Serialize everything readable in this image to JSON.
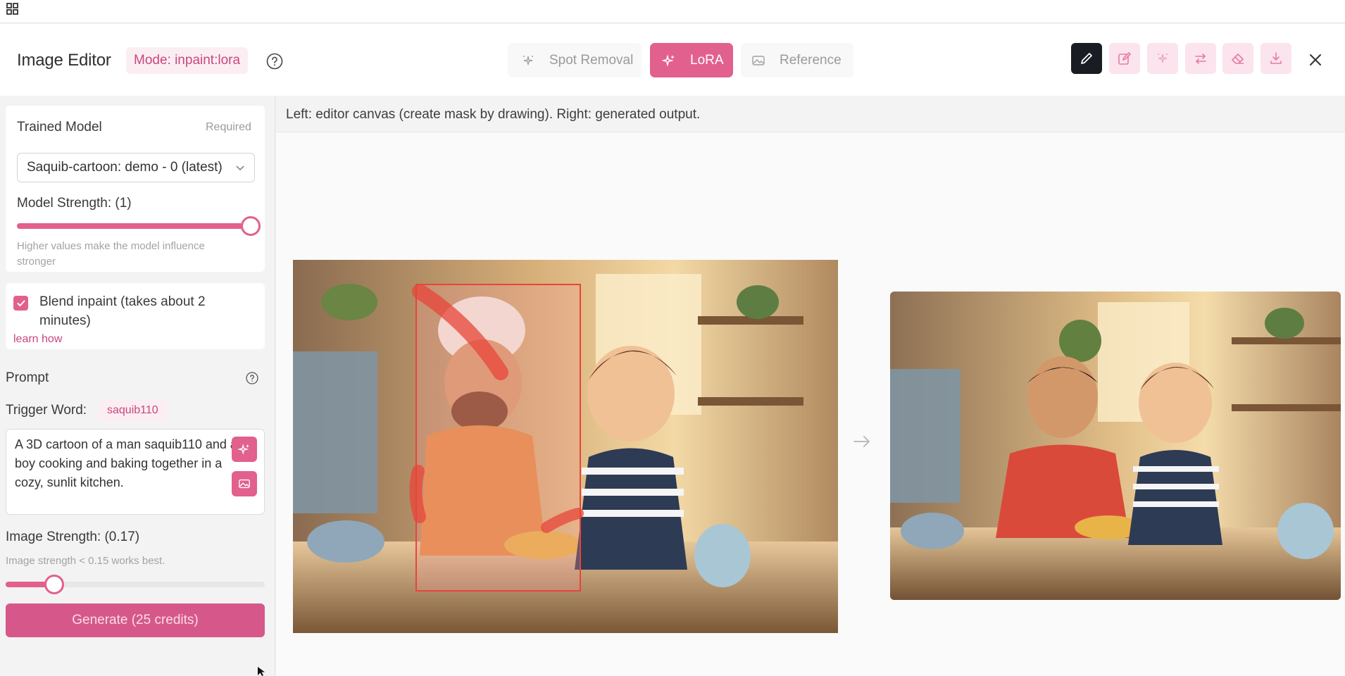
{
  "app": {
    "title": "Image Editor",
    "mode_badge": "Mode: inpaint:lora"
  },
  "tabs": [
    {
      "label": "Spot Removal",
      "icon": "sparkle-dots-icon",
      "active": false
    },
    {
      "label": "LoRA",
      "icon": "sparkles-icon",
      "active": true
    },
    {
      "label": "Reference",
      "icon": "image-icon",
      "active": false
    }
  ],
  "toolbar": {
    "tools": [
      "pencil-icon",
      "edit-icon",
      "magic-icon",
      "swap-icon",
      "eraser-icon",
      "download-icon"
    ],
    "active_tool": "pencil-icon"
  },
  "sidebar": {
    "trained_model": {
      "label": "Trained Model",
      "required": "Required",
      "selected": "Saquib-cartoon: demo - 0 (latest)"
    },
    "model_strength": {
      "label": "Model Strength: (1)",
      "value": 1,
      "hint": "Higher values make the model influence stronger"
    },
    "blend": {
      "checked": true,
      "label": "Blend inpaint (takes about 2 minutes)",
      "link": "learn how"
    },
    "prompt": {
      "label": "Prompt",
      "trigger_label": "Trigger Word:",
      "trigger_word": "saquib110",
      "text": "A 3D cartoon of a man saquib110 and a boy cooking and baking together in a cozy, sunlit kitchen."
    },
    "image_strength": {
      "label": "Image Strength: (0.17)",
      "value": 0.17,
      "hint": "Image strength < 0.15 works best."
    },
    "generate_label": "Generate (25 credits)"
  },
  "main": {
    "caption": "Left: editor canvas (create mask by drawing). Right: generated output."
  },
  "colors": {
    "accent": "#e2608e",
    "accent_light": "#fbeef3",
    "active_tool": "#1a1c24",
    "mask": "#e8453a"
  }
}
